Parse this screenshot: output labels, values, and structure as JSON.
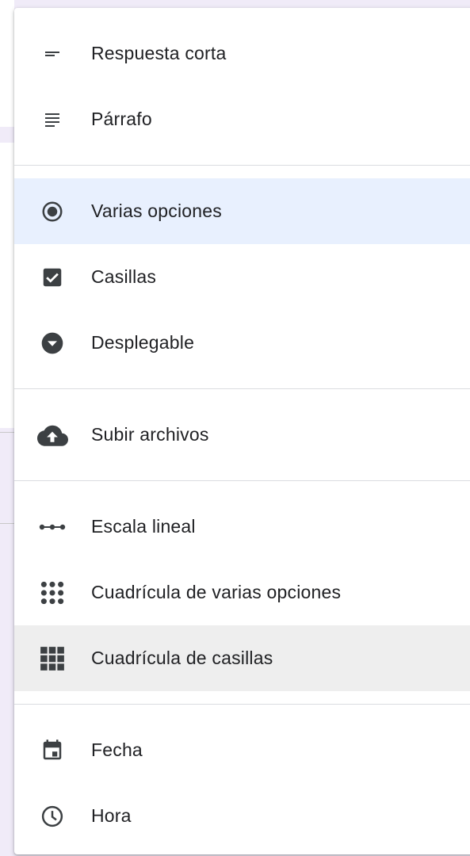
{
  "menu": {
    "groups": [
      {
        "items": [
          {
            "label": "Respuesta corta",
            "icon": "short-answer-icon"
          },
          {
            "label": "Párrafo",
            "icon": "paragraph-icon"
          }
        ]
      },
      {
        "items": [
          {
            "label": "Varias opciones",
            "icon": "radio-button-icon",
            "state": "selected"
          },
          {
            "label": "Casillas",
            "icon": "checkbox-icon"
          },
          {
            "label": "Desplegable",
            "icon": "dropdown-icon"
          }
        ]
      },
      {
        "items": [
          {
            "label": "Subir archivos",
            "icon": "cloud-upload-icon"
          }
        ]
      },
      {
        "items": [
          {
            "label": "Escala lineal",
            "icon": "linear-scale-icon"
          },
          {
            "label": "Cuadrícula de varias opciones",
            "icon": "multiple-choice-grid-icon"
          },
          {
            "label": "Cuadrícula de casillas",
            "icon": "checkbox-grid-icon",
            "state": "hovered"
          }
        ]
      },
      {
        "items": [
          {
            "label": "Fecha",
            "icon": "calendar-icon"
          },
          {
            "label": "Hora",
            "icon": "clock-icon"
          }
        ]
      }
    ]
  },
  "colors": {
    "icon": "#5f6368",
    "icon_dark": "#3c4043",
    "text": "#202124",
    "selected_bg": "#e8f0fe",
    "hover_bg": "#eeeeee",
    "divider": "#dadce0",
    "page_bg": "#f0ebf8"
  }
}
